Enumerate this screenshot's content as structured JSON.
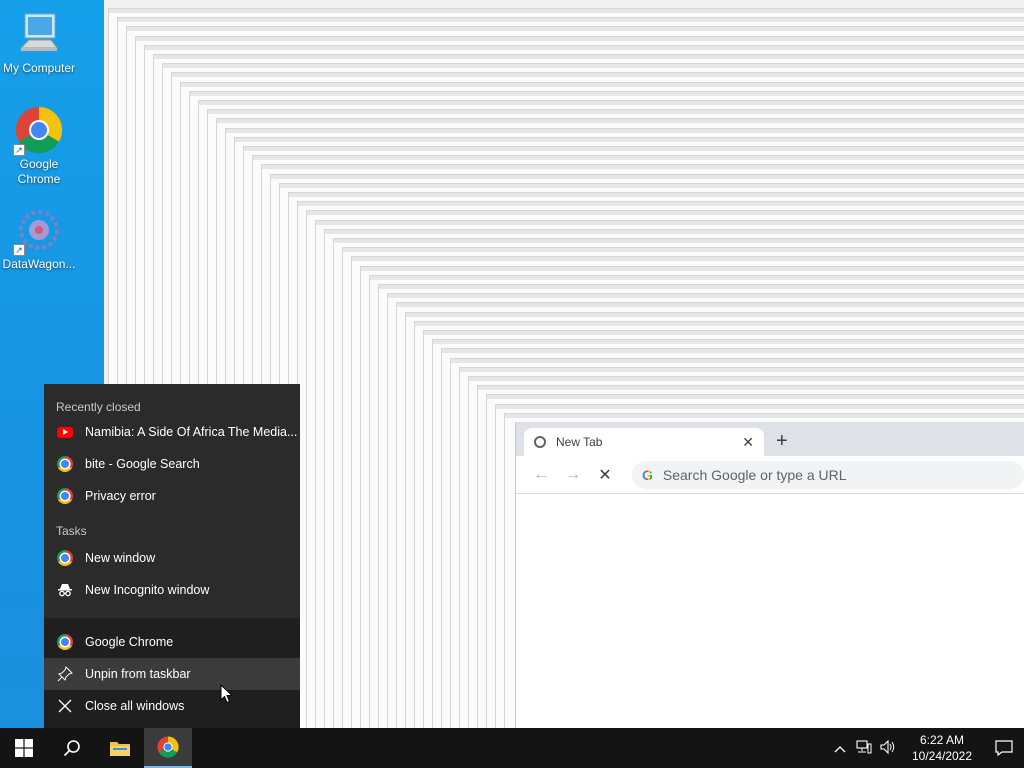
{
  "desktop": {
    "icons": [
      {
        "label": "My Computer",
        "icon": "computer-icon"
      },
      {
        "label": "Google Chrome",
        "icon": "chrome-icon"
      },
      {
        "label": "DataWagon...",
        "icon": "datawagon-icon"
      }
    ]
  },
  "chrome_window": {
    "tab_title": "New Tab",
    "omnibox_placeholder": "Search Google or type a URL",
    "new_tab_symbol": "+",
    "close_tab_symbol": "✕"
  },
  "jumplist": {
    "recently_closed_heading": "Recently closed",
    "recently_closed": [
      {
        "label": "Namibia: A Side Of Africa The Media...",
        "icon": "youtube-icon"
      },
      {
        "label": "bite - Google Search",
        "icon": "chrome-icon"
      },
      {
        "label": "Privacy error",
        "icon": "chrome-icon"
      }
    ],
    "tasks_heading": "Tasks",
    "tasks": [
      {
        "label": "New window",
        "icon": "chrome-icon"
      },
      {
        "label": "New Incognito window",
        "icon": "incognito-icon"
      }
    ],
    "app_label": "Google Chrome",
    "unpin_label": "Unpin from taskbar",
    "close_all_label": "Close all windows"
  },
  "taskbar": {
    "time": "6:22 AM",
    "date": "10/24/2022"
  },
  "colors": {
    "desktop": "#1792e0",
    "jumplist_bg": "#2b2b2b",
    "taskbar_bg": "#141414",
    "accent": "#76b9ed"
  }
}
